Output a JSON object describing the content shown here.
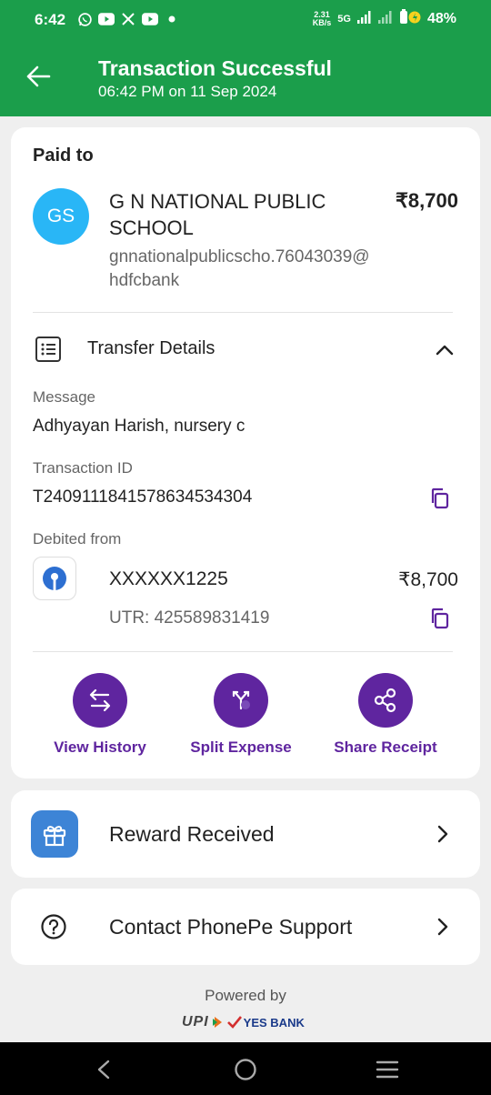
{
  "status_bar": {
    "time": "6:42",
    "net_speed_value": "2.31",
    "net_speed_unit": "KB/s",
    "network": "5G",
    "battery": "48%",
    "notification_icons": [
      "whatsapp-icon",
      "youtube-icon",
      "x-icon",
      "youtube-icon",
      "dot-icon"
    ]
  },
  "header": {
    "title": "Transaction Successful",
    "subtitle": "06:42 PM on 11 Sep 2024",
    "color": "#1b9e4b"
  },
  "payment": {
    "paid_to_label": "Paid to",
    "avatar_initials": "GS",
    "payee_name": "G N NATIONAL PUBLIC SCHOOL",
    "payee_upi": "gnnationalpublicscho.76043039@hdfcbank",
    "amount": "₹8,700"
  },
  "transfer_details": {
    "heading": "Transfer Details",
    "message_label": "Message",
    "message_value": "Adhyayan Harish, nursery c",
    "txn_id_label": "Transaction ID",
    "txn_id_value": "T2409111841578634534304",
    "debited_label": "Debited from",
    "account": "XXXXXX1225",
    "debited_amount": "₹8,700",
    "utr": "UTR: 425589831419"
  },
  "actions": [
    {
      "label": "View History",
      "icon": "transfer-arrows-icon"
    },
    {
      "label": "Split Expense",
      "icon": "split-icon"
    },
    {
      "label": "Share Receipt",
      "icon": "share-icon"
    }
  ],
  "reward": {
    "label": "Reward Received",
    "icon": "gift-icon"
  },
  "support": {
    "label": "Contact PhonePe Support",
    "icon": "help-circle-icon"
  },
  "footer": {
    "powered_by": "Powered by",
    "upi": "UPI",
    "bank": "YES BANK"
  },
  "accent_color": "#5f259f"
}
